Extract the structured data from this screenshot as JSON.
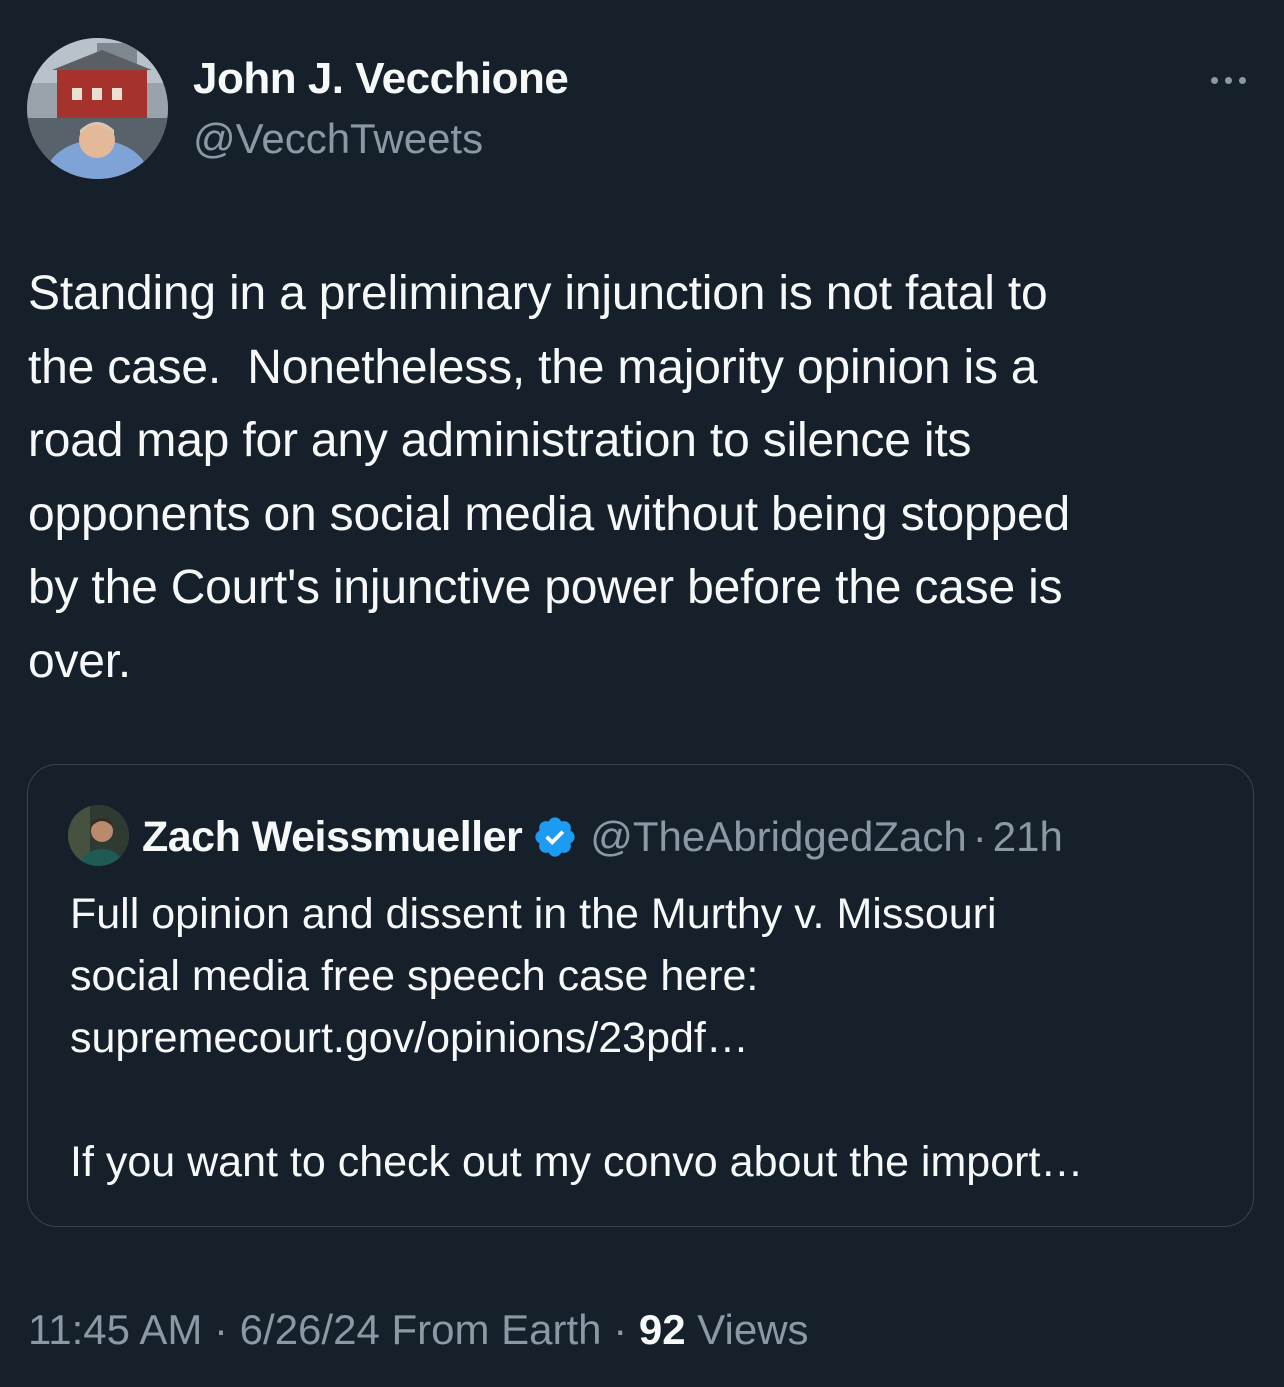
{
  "tweet": {
    "author_name": "John J. Vecchione",
    "author_handle": "@VecchTweets",
    "more_icon": "more-horizontal-icon",
    "text": "Standing in a preliminary injunction is not fatal to\nthe case.  Nonetheless, the majority opinion is a\nroad map for any administration to silence its\nopponents on social media without being stopped\nby the Court's injunctive power before the case is\nover."
  },
  "quote": {
    "author_name": "Zach Weissmueller",
    "verified_icon": "verified-badge-icon",
    "author_handle": "@TheAbridgedZach",
    "separator": "·",
    "time": "21h",
    "text_line1": "Full opinion and dissent in the Murthy v. Missouri",
    "text_line2": "social media free speech case here:",
    "link": "supremecourt.gov/opinions/23pdf…",
    "text_truncated": "If you want to check out my convo about the import…"
  },
  "meta": {
    "time": "11:45 AM",
    "sep1": " · ",
    "date": "6/26/24",
    "source": " From Earth",
    "sep2": " · ",
    "views_count": "92",
    "views_label": " Views"
  },
  "colors": {
    "background": "#15202b",
    "text_primary": "#f7f9f9",
    "text_secondary": "#8b98a5",
    "border": "#38444d",
    "verified_blue": "#1d9bf0"
  }
}
